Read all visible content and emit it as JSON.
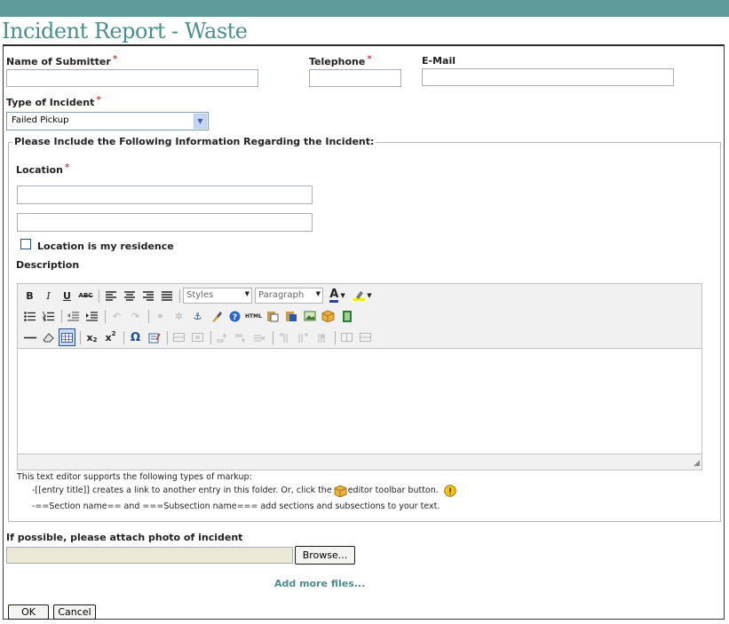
{
  "page": {
    "title": "Incident Report - Waste"
  },
  "form": {
    "submitter_label": "Name of Submitter",
    "submitter_value": "",
    "telephone_label": "Telephone",
    "telephone_value": "",
    "email_label": "E-Mail",
    "email_value": "",
    "required_mark": "*",
    "incident_type_label": "Type of Incident",
    "incident_type_value": "Failed Pickup",
    "section_legend": "Please Include the Following Information Regarding the Incident:",
    "location_label": "Location",
    "location_line1": "",
    "location_line2": "",
    "residence_checkbox_label": "Location is my residence",
    "residence_checked": false,
    "description_label": "Description",
    "editor": {
      "styles_value": "Styles",
      "format_value": "Paragraph",
      "bold": "B",
      "italic": "I",
      "underline": "U",
      "strike": "ABC",
      "html": "HTML",
      "subscript": "x",
      "superscript": "x",
      "omega": "Ω",
      "font_color": "A"
    },
    "help": {
      "intro": "This text editor supports the following types of markup:",
      "line1_a": "-[[entry title]] creates a link to another entry in this folder. Or, click the",
      "line1_b": "editor toolbar button.",
      "line2": "-==Section name== and ===Subsection name=== add sections and subsections to your text."
    },
    "photo_label": "If possible, please attach photo of incident",
    "browse_button": "Browse...",
    "add_more_link": "Add more files...",
    "ok_button": "OK",
    "cancel_button": "Cancel"
  },
  "colors": {
    "topbar": "#5f9c99",
    "title": "#4a8f8c",
    "required": "#cc0000",
    "link": "#4a8f8c"
  }
}
